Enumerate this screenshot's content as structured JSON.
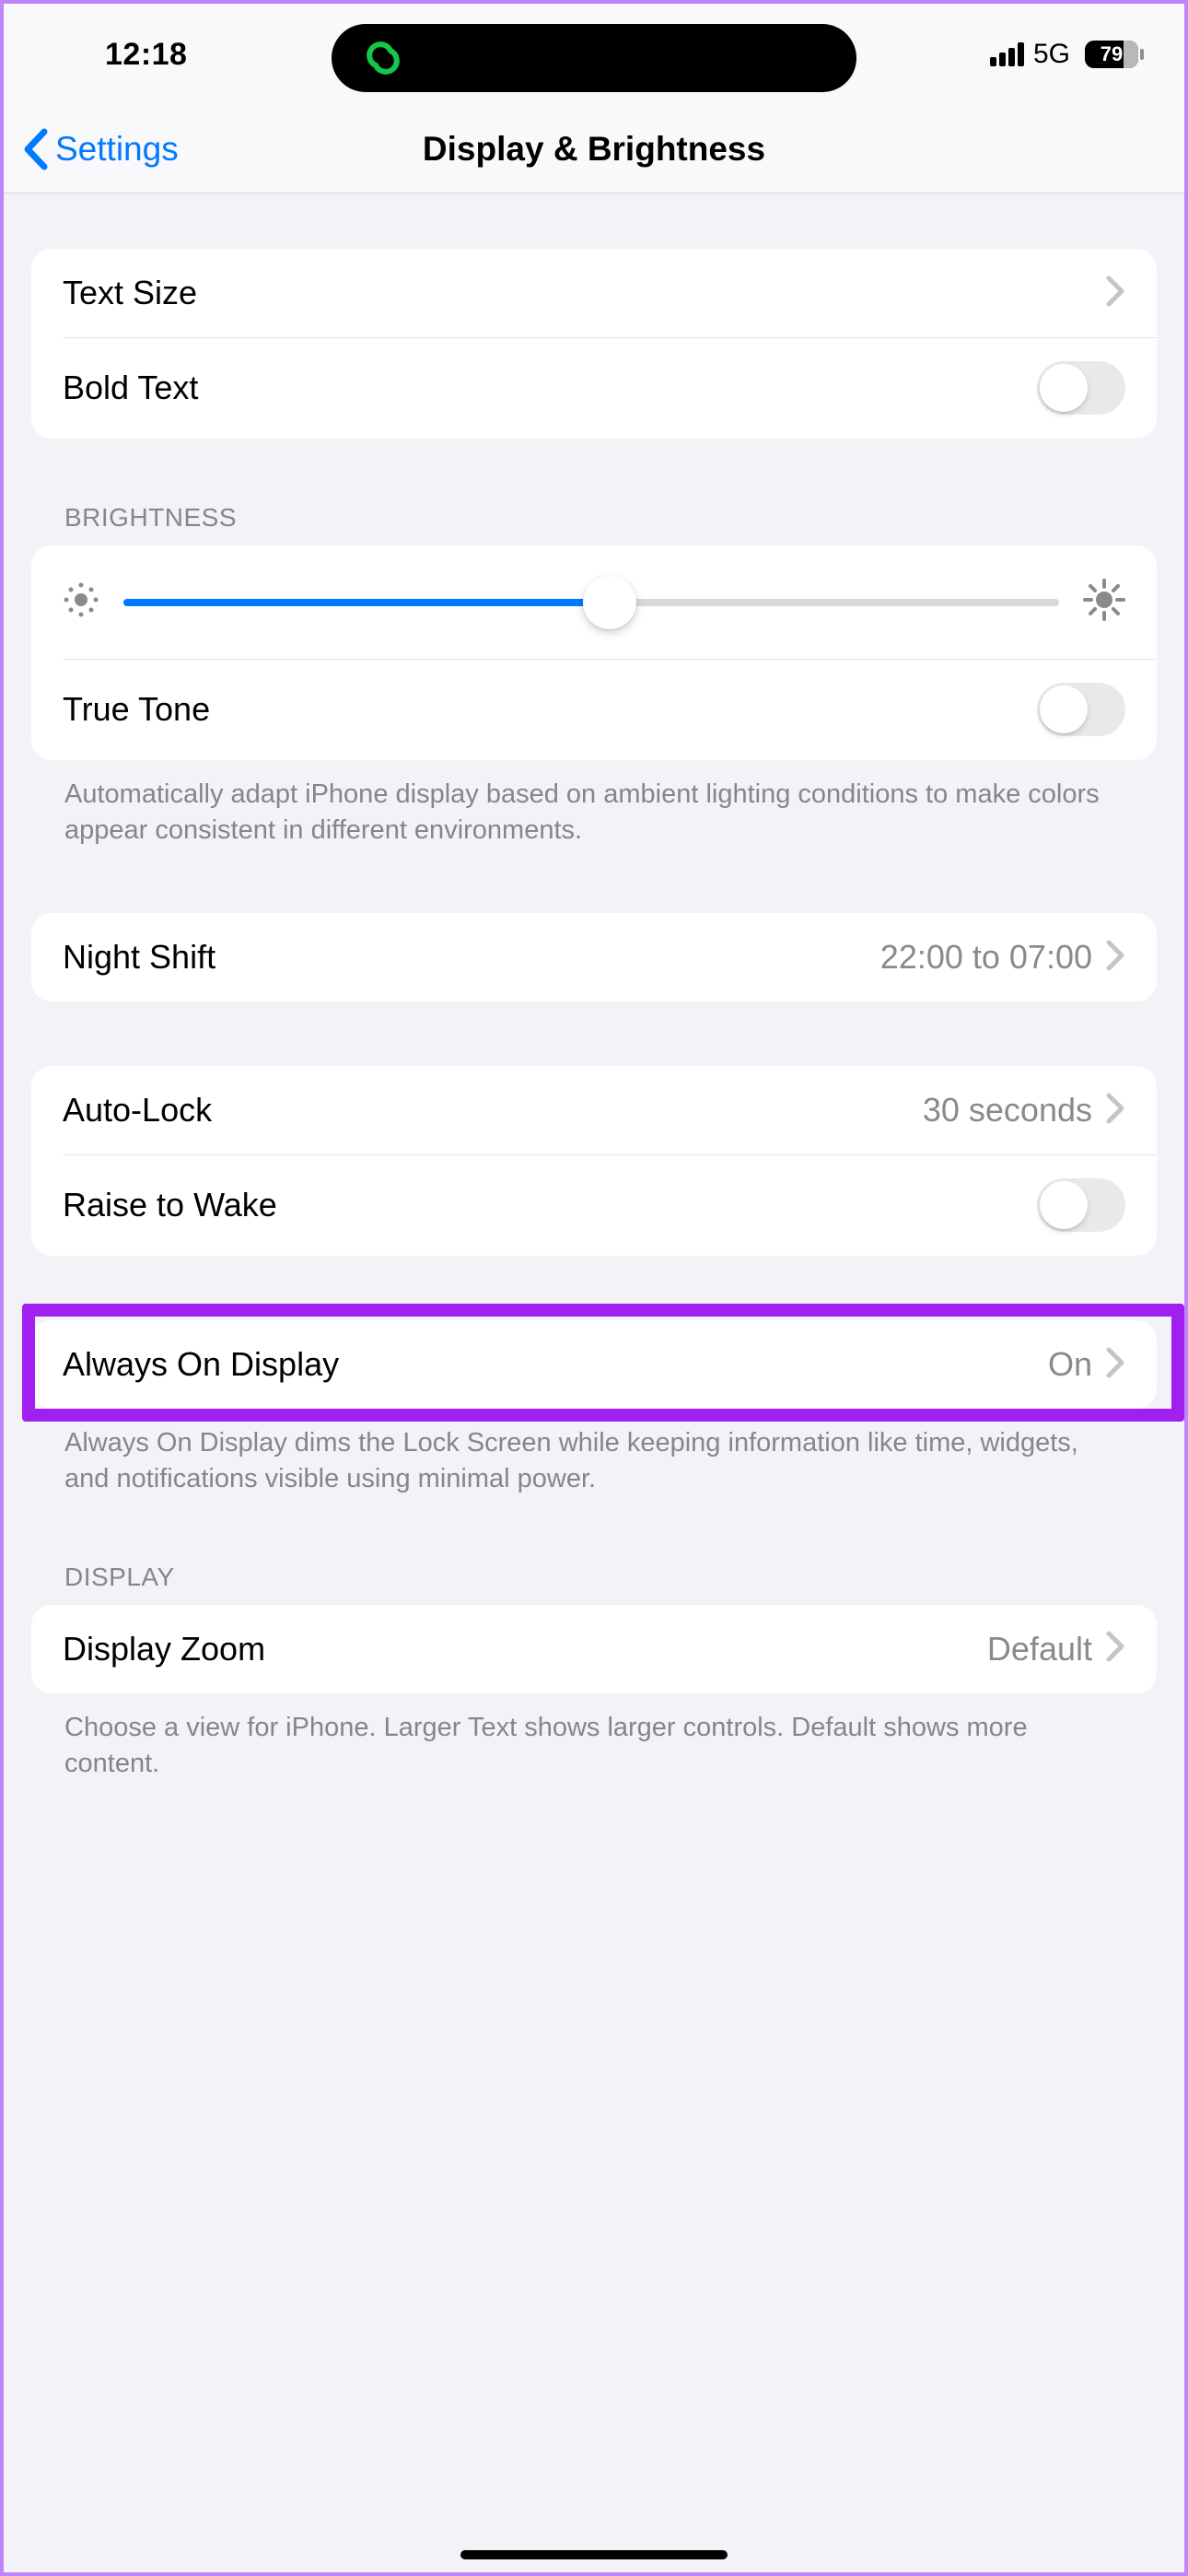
{
  "status": {
    "time": "12:18",
    "network": "5G",
    "battery": "79"
  },
  "nav": {
    "back": "Settings",
    "title": "Display & Brightness"
  },
  "sections": {
    "text": {
      "text_size": "Text Size",
      "bold_text": "Bold Text"
    },
    "brightness": {
      "header": "Brightness",
      "true_tone": "True Tone",
      "footer": "Automatically adapt iPhone display based on ambient lighting conditions to make colors appear consistent in different environments."
    },
    "night_shift": {
      "label": "Night Shift",
      "value": "22:00 to 07:00"
    },
    "lock": {
      "auto_lock_label": "Auto-Lock",
      "auto_lock_value": "30 seconds",
      "raise_to_wake": "Raise to Wake"
    },
    "aod": {
      "label": "Always On Display",
      "value": "On",
      "footer": "Always On Display dims the Lock Screen while keeping information like time, widgets, and notifications visible using minimal power."
    },
    "display": {
      "header": "Display",
      "zoom_label": "Display Zoom",
      "zoom_value": "Default",
      "footer": "Choose a view for iPhone. Larger Text shows larger controls. Default shows more content."
    }
  }
}
